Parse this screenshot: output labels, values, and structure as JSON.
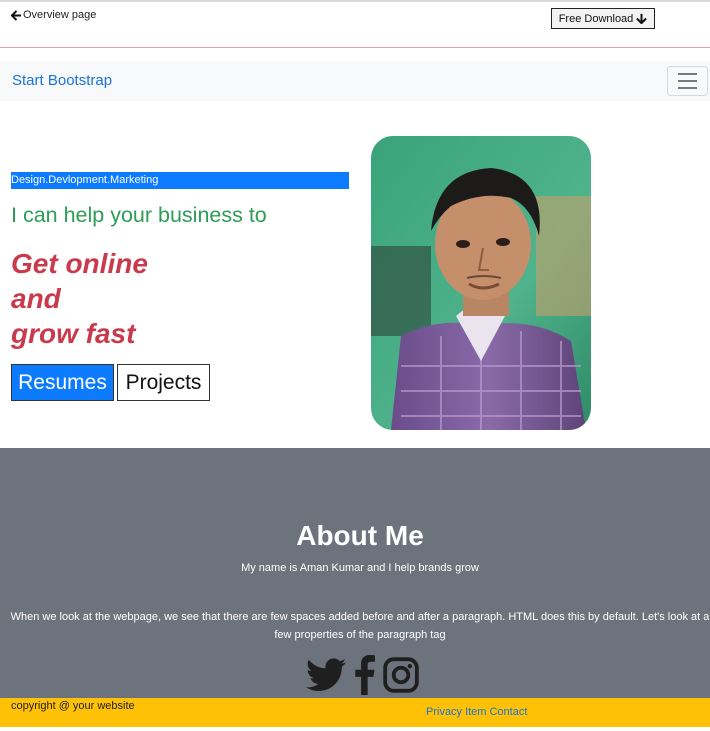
{
  "topbar": {
    "back_label": "Overview page",
    "back_icon": "arrow-left-icon",
    "download_label": "Free Download",
    "download_icon": "arrow-down-icon"
  },
  "navbar": {
    "brand": "Start Bootstrap",
    "toggler_icon": "hamburger-menu-icon"
  },
  "hero": {
    "tagline": "Design.Devlopment.Marketing",
    "headline": "I can help your business to",
    "big_lines": [
      "Get online",
      "and",
      "grow fast"
    ],
    "button_primary": "Resumes",
    "button_secondary": "Projects",
    "photo": "profile-photo"
  },
  "about": {
    "title": "About Me",
    "subtitle": "My name is Aman Kumar and I help brands grow",
    "paragraph": "When we look at the webpage, we see that there are few spaces added before and after a paragraph. HTML does this by default. Let's look at a few properties of the paragraph tag",
    "socials": [
      "twitter-icon",
      "facebook-icon",
      "instagram-icon"
    ]
  },
  "footer": {
    "copyright": "copyright @ your website",
    "links": [
      "Privacy",
      "Item",
      "Contact"
    ]
  },
  "colors": {
    "accent_blue": "#0d7bff",
    "link_blue": "#1a73d9",
    "headline_green": "#2e9d56",
    "big_text_red": "#c93a4d",
    "about_bg": "#6c737c",
    "footer_bg": "#fec106"
  }
}
